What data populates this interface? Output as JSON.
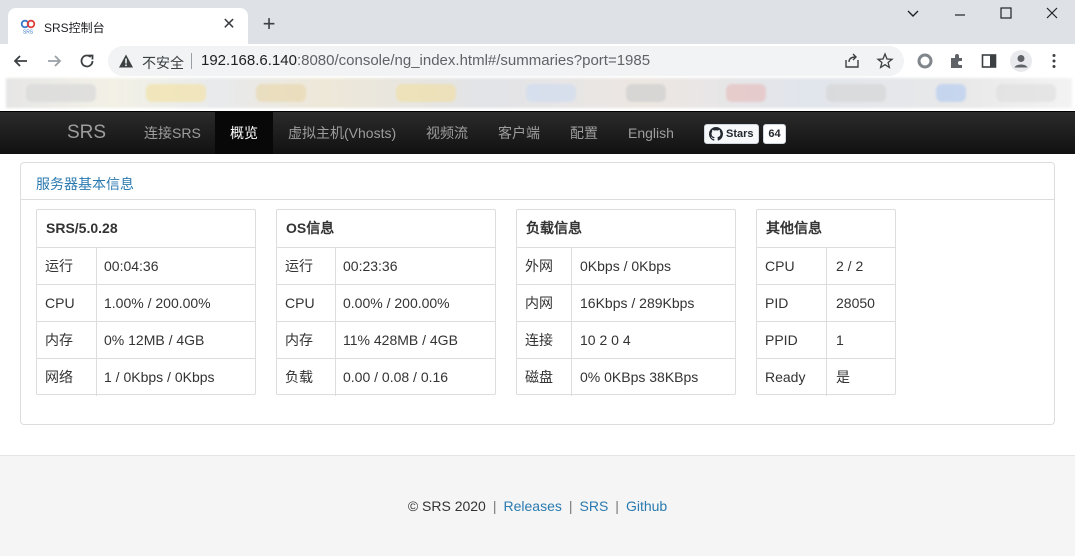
{
  "browser": {
    "tab_title": "SRS控制台",
    "new_tab": "+",
    "insecure_label": "不安全",
    "url_host": "192.168.6.140",
    "url_rest": ":8080/console/ng_index.html#/summaries?port=1985"
  },
  "nav": {
    "brand": "SRS",
    "items": [
      "连接SRS",
      "概览",
      "虚拟主机(Vhosts)",
      "视频流",
      "客户端",
      "配置",
      "English"
    ],
    "active_index": 1,
    "github_stars_label": "Stars",
    "github_stars_count": "64"
  },
  "panel": {
    "title": "服务器基本信息"
  },
  "cards": [
    {
      "title": "SRS/5.0.28",
      "rows": [
        {
          "label": "运行",
          "value": "00:04:36"
        },
        {
          "label": "CPU",
          "value": "1.00% / 200.00%"
        },
        {
          "label": "内存",
          "value": "0% 12MB / 4GB"
        },
        {
          "label": "网络",
          "value": "1 / 0Kbps / 0Kbps"
        }
      ]
    },
    {
      "title": "OS信息",
      "rows": [
        {
          "label": "运行",
          "value": "00:23:36"
        },
        {
          "label": "CPU",
          "value": "0.00% / 200.00%"
        },
        {
          "label": "内存",
          "value": "11% 428MB / 4GB"
        },
        {
          "label": "负载",
          "value": "0.00 / 0.08 / 0.16"
        }
      ]
    },
    {
      "title": "负载信息",
      "rows": [
        {
          "label": "外网",
          "value": "0Kbps / 0Kbps"
        },
        {
          "label": "内网",
          "value": "16Kbps / 289Kbps"
        },
        {
          "label": "连接",
          "value": "10 2 0 4"
        },
        {
          "label": "磁盘",
          "value": "0% 0KBps 38KBps"
        }
      ]
    },
    {
      "title": "其他信息",
      "rows": [
        {
          "label": "CPU",
          "value": "2 / 2"
        },
        {
          "label": "PID",
          "value": "28050"
        },
        {
          "label": "PPID",
          "value": "1"
        },
        {
          "label": "Ready",
          "value": "是"
        }
      ]
    }
  ],
  "footer": {
    "copyright": "© SRS 2020",
    "separator": "|",
    "links": [
      "Releases",
      "SRS",
      "Github"
    ]
  },
  "colors": {
    "link": "#2a7ab0",
    "navbar": "#222222",
    "nav_active": "#080808"
  }
}
